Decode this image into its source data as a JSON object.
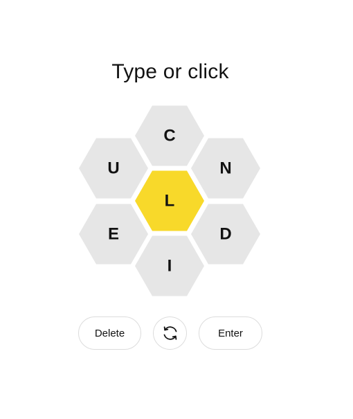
{
  "prompt": "Type or click",
  "letters": {
    "center": "L",
    "outer": [
      "C",
      "N",
      "D",
      "I",
      "E",
      "U"
    ]
  },
  "controls": {
    "delete_label": "Delete",
    "shuffle_icon": "shuffle-icon",
    "enter_label": "Enter"
  },
  "colors": {
    "center_fill": "#f8d92a",
    "outer_fill": "#e6e6e6",
    "text": "#121212",
    "button_border": "#dcdcdc"
  }
}
